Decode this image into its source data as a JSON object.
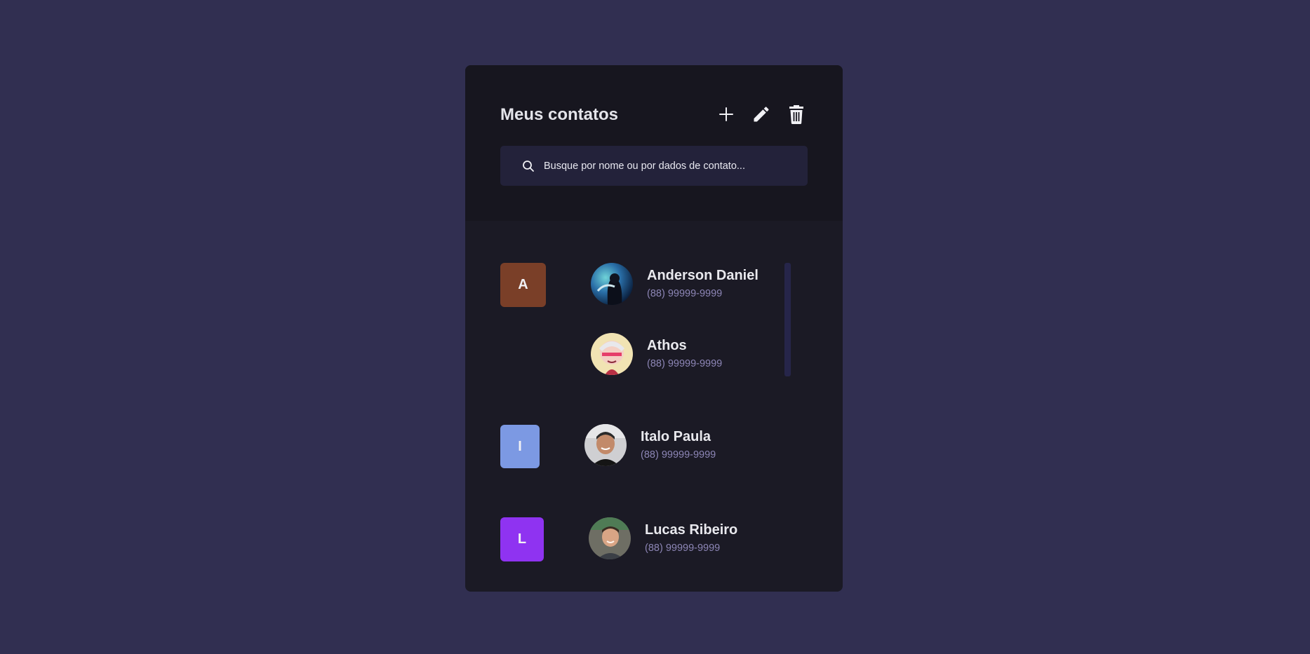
{
  "header": {
    "title": "Meus contatos",
    "add_icon": "plus-icon",
    "edit_icon": "pencil-icon",
    "delete_icon": "trash-icon"
  },
  "search": {
    "placeholder": "Busque por nome ou por dados de contato...",
    "icon": "search-icon"
  },
  "groups": [
    {
      "letter": "A",
      "color": "#7a3f28",
      "contacts": [
        {
          "name": "Anderson Daniel",
          "phone": "(88) 99999-9999"
        },
        {
          "name": "Athos",
          "phone": "(88) 99999-9999"
        }
      ]
    },
    {
      "letter": "I",
      "color": "#7c99e3",
      "contacts": [
        {
          "name": "Italo Paula",
          "phone": "(88) 99999-9999"
        }
      ]
    },
    {
      "letter": "L",
      "color": "#8f33f1",
      "contacts": [
        {
          "name": "Lucas Ribeiro",
          "phone": "(88) 99999-9999"
        }
      ]
    }
  ],
  "colors": {
    "page_background": "#312f51",
    "card_background": "#1b1a25",
    "header_background": "#17161f",
    "search_background": "#23223a",
    "phone_text": "#8d86b6"
  }
}
